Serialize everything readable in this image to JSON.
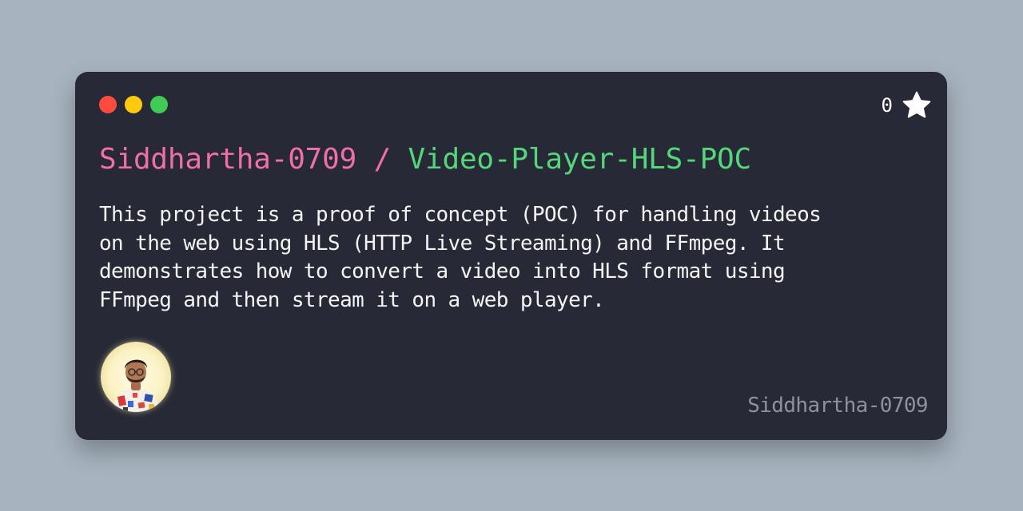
{
  "window": {
    "traffic_lights": [
      {
        "name": "close",
        "color": "#ff4b3e"
      },
      {
        "name": "minimize",
        "color": "#ffc90e"
      },
      {
        "name": "maximize",
        "color": "#3fcb56"
      }
    ]
  },
  "repo": {
    "owner": "Siddhartha-0709",
    "separator": " / ",
    "name": "Video-Player-HLS-POC",
    "description": "This project is a proof of concept (POC) for handling videos on the web using HLS (HTTP Live Streaming) and FFmpeg. It demonstrates how to convert a video into HLS format using FFmpeg and then stream it on a web player.",
    "stars": "0",
    "star_icon": "star-icon"
  },
  "author": {
    "username": "Siddhartha-0709",
    "avatar_icon": "avatar"
  },
  "colors": {
    "background": "#a7b3bf",
    "card": "#272a36",
    "owner": "#f06eab",
    "repo_name": "#54d67b",
    "description": "#f4f4f4",
    "username": "#8f929c"
  }
}
